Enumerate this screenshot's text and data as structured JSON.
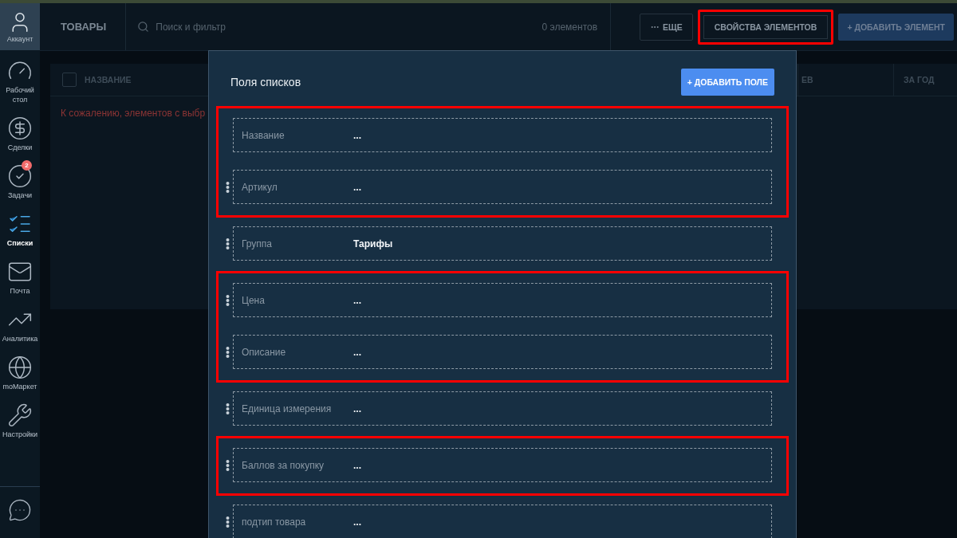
{
  "sidebar": {
    "account": {
      "label": "Аккаунт"
    },
    "items": [
      {
        "kind": "desk",
        "label": "Рабочий стол",
        "selected": false
      },
      {
        "kind": "deals",
        "label": "Сделки",
        "selected": false
      },
      {
        "kind": "tasks",
        "label": "Задачи",
        "selected": false,
        "badge": "2"
      },
      {
        "kind": "lists",
        "label": "Списки",
        "selected": true
      },
      {
        "kind": "mail",
        "label": "Почта",
        "selected": false
      },
      {
        "kind": "analytics",
        "label": "Аналитика",
        "selected": false
      },
      {
        "kind": "market",
        "label": "moМаркет",
        "selected": false
      },
      {
        "kind": "settings",
        "label": "Настройки",
        "selected": false
      }
    ]
  },
  "topbar": {
    "title": "ТОВАРЫ",
    "search": {
      "placeholder": "Поиск и фильтр"
    },
    "count": "0 элементов",
    "buttons": [
      {
        "kind": "more",
        "label": "ЕЩЕ",
        "highlighted": false
      },
      {
        "kind": "plain",
        "label": "СВОЙСТВА ЭЛЕМЕНТОВ",
        "highlighted": true
      },
      {
        "kind": "primary",
        "label": "+ ДОБАВИТЬ ЭЛЕМЕНТ",
        "highlighted": false
      }
    ]
  },
  "table": {
    "select_all": {
      "checked": false
    },
    "columns": [
      {
        "label": "НАЗВАНИЕ"
      },
      {
        "label": "ЕВ"
      },
      {
        "label": "ЗА ГОД"
      }
    ],
    "message": "К сожалению, элементов с выбр"
  },
  "modal": {
    "title": "Поля списков",
    "add_button": "+ ДОБАВИТЬ ПОЛЕ",
    "field_groups": [
      {
        "highlighted": true,
        "fields": [
          {
            "label": "Название",
            "value": "...",
            "draggable": false
          },
          {
            "label": "Артикул",
            "value": "...",
            "draggable": true
          }
        ]
      },
      {
        "highlighted": false,
        "fields": [
          {
            "label": "Группа",
            "value": "Тарифы",
            "draggable": true
          }
        ]
      },
      {
        "highlighted": true,
        "fields": [
          {
            "label": "Цена",
            "value": "...",
            "draggable": true
          },
          {
            "label": "Описание",
            "value": "...",
            "draggable": true
          }
        ]
      },
      {
        "highlighted": false,
        "fields": [
          {
            "label": "Единица измерения",
            "value": "...",
            "draggable": true
          }
        ]
      },
      {
        "highlighted": true,
        "fields": [
          {
            "label": "Баллов за покупку",
            "value": "...",
            "draggable": true
          }
        ]
      },
      {
        "highlighted": false,
        "fields": [
          {
            "label": "подтип товара",
            "value": "...",
            "draggable": true
          }
        ]
      }
    ]
  }
}
